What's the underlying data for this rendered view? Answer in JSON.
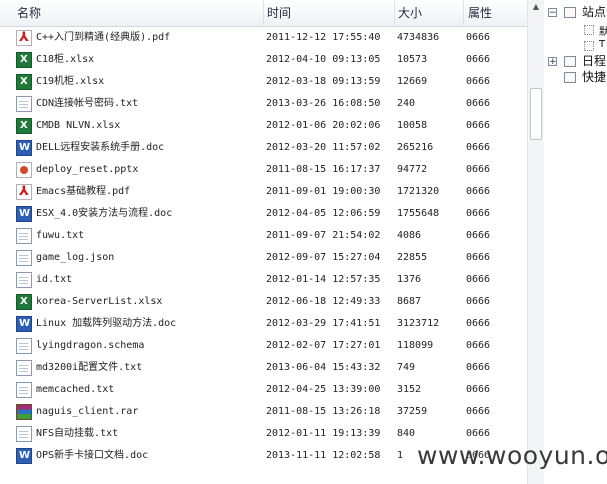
{
  "columns": {
    "name": "名称",
    "time": "时间",
    "size": "大小",
    "attr": "属性"
  },
  "files": [
    {
      "icon": "pdf-icon",
      "name": "C++入门到精通(经典版).pdf",
      "time": "2011-12-12 17:55:40",
      "size": "4734836",
      "attr": "0666"
    },
    {
      "icon": "xlsx-icon",
      "name": "C18柜.xlsx",
      "time": "2012-04-10 09:13:05",
      "size": "10573",
      "attr": "0666"
    },
    {
      "icon": "xlsx-icon",
      "name": "C19机柜.xlsx",
      "time": "2012-03-18 09:13:59",
      "size": "12669",
      "attr": "0666"
    },
    {
      "icon": "txt-icon",
      "name": "CDN连接帐号密码.txt",
      "time": "2013-03-26 16:08:50",
      "size": "240",
      "attr": "0666"
    },
    {
      "icon": "xlsx-icon",
      "name": "CMDB NLVN.xlsx",
      "time": "2012-01-06 20:02:06",
      "size": "10058",
      "attr": "0666"
    },
    {
      "icon": "doc-icon",
      "name": "DELL远程安装系统手册.doc",
      "time": "2012-03-20 11:57:02",
      "size": "265216",
      "attr": "0666"
    },
    {
      "icon": "pptx-icon",
      "name": "deploy_reset.pptx",
      "time": "2011-08-15 16:17:37",
      "size": "94772",
      "attr": "0666"
    },
    {
      "icon": "pdf-icon",
      "name": "Emacs基础教程.pdf",
      "time": "2011-09-01 19:00:30",
      "size": "1721320",
      "attr": "0666"
    },
    {
      "icon": "doc-icon",
      "name": "ESX_4.0安装方法与流程.doc",
      "time": "2012-04-05 12:06:59",
      "size": "1755648",
      "attr": "0666"
    },
    {
      "icon": "txt-icon",
      "name": "fuwu.txt",
      "time": "2011-09-07 21:54:02",
      "size": "4086",
      "attr": "0666"
    },
    {
      "icon": "txt-icon",
      "name": "game_log.json",
      "time": "2012-09-07 15:27:04",
      "size": "22855",
      "attr": "0666"
    },
    {
      "icon": "txt-icon",
      "name": "id.txt",
      "time": "2012-01-14 12:57:35",
      "size": "1376",
      "attr": "0666"
    },
    {
      "icon": "xlsx-icon",
      "name": "korea-ServerList.xlsx",
      "time": "2012-06-18 12:49:33",
      "size": "8687",
      "attr": "0666"
    },
    {
      "icon": "doc-icon",
      "name": "Linux 加载阵列驱动方法.doc",
      "time": "2012-03-29 17:41:51",
      "size": "3123712",
      "attr": "0666"
    },
    {
      "icon": "txt-icon",
      "name": "lyingdragon.schema",
      "time": "2012-02-07 17:27:01",
      "size": "118099",
      "attr": "0666"
    },
    {
      "icon": "txt-icon",
      "name": "md3200i配置文件.txt",
      "time": "2013-06-04 15:43:32",
      "size": "749",
      "attr": "0666"
    },
    {
      "icon": "txt-icon",
      "name": "memcached.txt",
      "time": "2012-04-25 13:39:00",
      "size": "3152",
      "attr": "0666"
    },
    {
      "icon": "rar-icon",
      "name": "naguis_client.rar",
      "time": "2011-08-15 13:26:18",
      "size": "37259",
      "attr": "0666"
    },
    {
      "icon": "txt-icon",
      "name": "NFS自动挂载.txt",
      "time": "2012-01-11 19:13:39",
      "size": "840",
      "attr": "0666"
    },
    {
      "icon": "doc-icon",
      "name": "OPS新手卡接口文档.doc",
      "time": "2013-11-11 12:02:58",
      "size": "1",
      "attr": "0666"
    }
  ],
  "tree": {
    "root_label": "站点",
    "child1_label": "默",
    "child2_label": "T",
    "node2_label": "日程",
    "node3_label": "快捷"
  },
  "watermark": "www.wooyun.org"
}
